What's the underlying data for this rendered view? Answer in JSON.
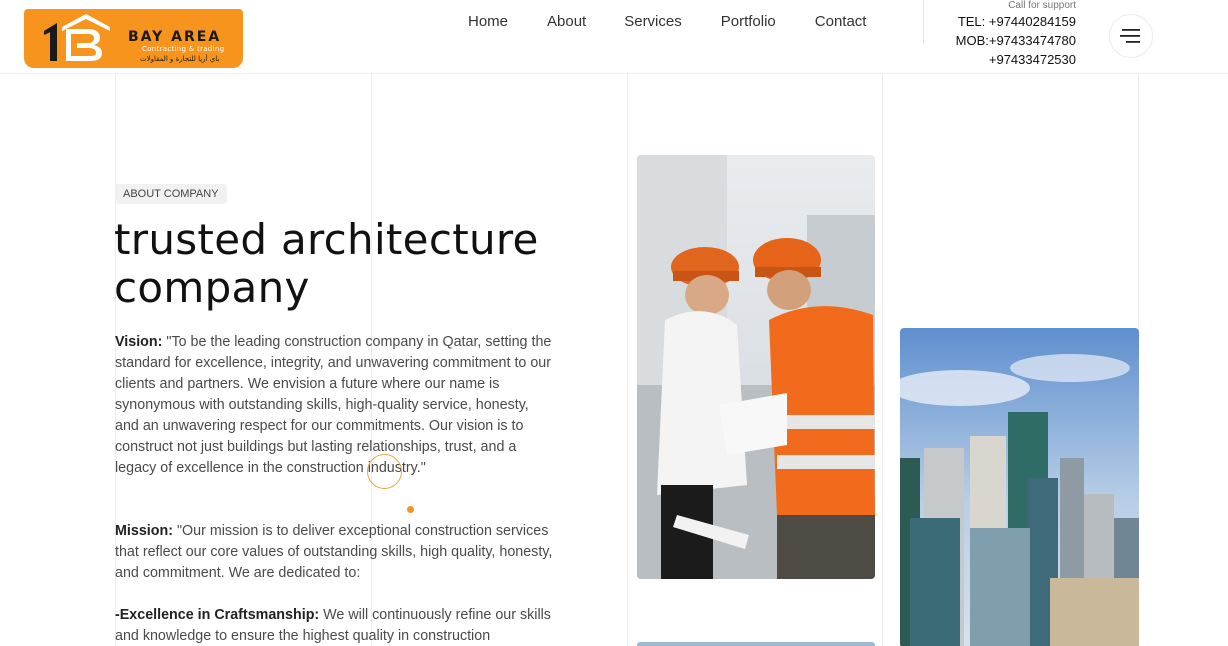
{
  "brand": {
    "logo_title": "BAY AREA",
    "logo_subtitle": "Contracting & trading",
    "logo_arabic": "باي أريا للتجارة و المقاولات",
    "logo_color": "#f7941d"
  },
  "nav": {
    "items": [
      "Home",
      "About",
      "Services",
      "Portfolio",
      "Contact"
    ]
  },
  "support": {
    "label": "Call for support",
    "tel": "TEL: +97440284159",
    "mob": "MOB:+97433474780",
    "alt": "+97433472530"
  },
  "about": {
    "tag": "ABOUT COMPANY",
    "headline_line1": "trusted architecture",
    "headline_line2": "company",
    "vision_label": "Vision:",
    "vision_text": " \"To be the leading construction company in Qatar, setting the standard for excellence, integrity, and unwavering commitment to our clients and partners. We envision a future where our name is synonymous with outstanding skills, high-quality service, honesty, and an unwavering respect for our commitments. Our vision is to construct not just buildings but lasting relationships, trust, and a legacy of excellence in the construction industry.\"",
    "mission_label": "Mission:",
    "mission_text": " \"Our mission is to deliver exceptional construction services that reflect our core values of outstanding skills, high quality, honesty, and commitment. We are dedicated to:",
    "excellence_label": "-Excellence in Craftsmanship:",
    "excellence_text": " We will continuously refine our skills and knowledge to ensure the highest quality in construction"
  },
  "colors": {
    "accent": "#f7941d",
    "text": "#4a4a4a"
  }
}
